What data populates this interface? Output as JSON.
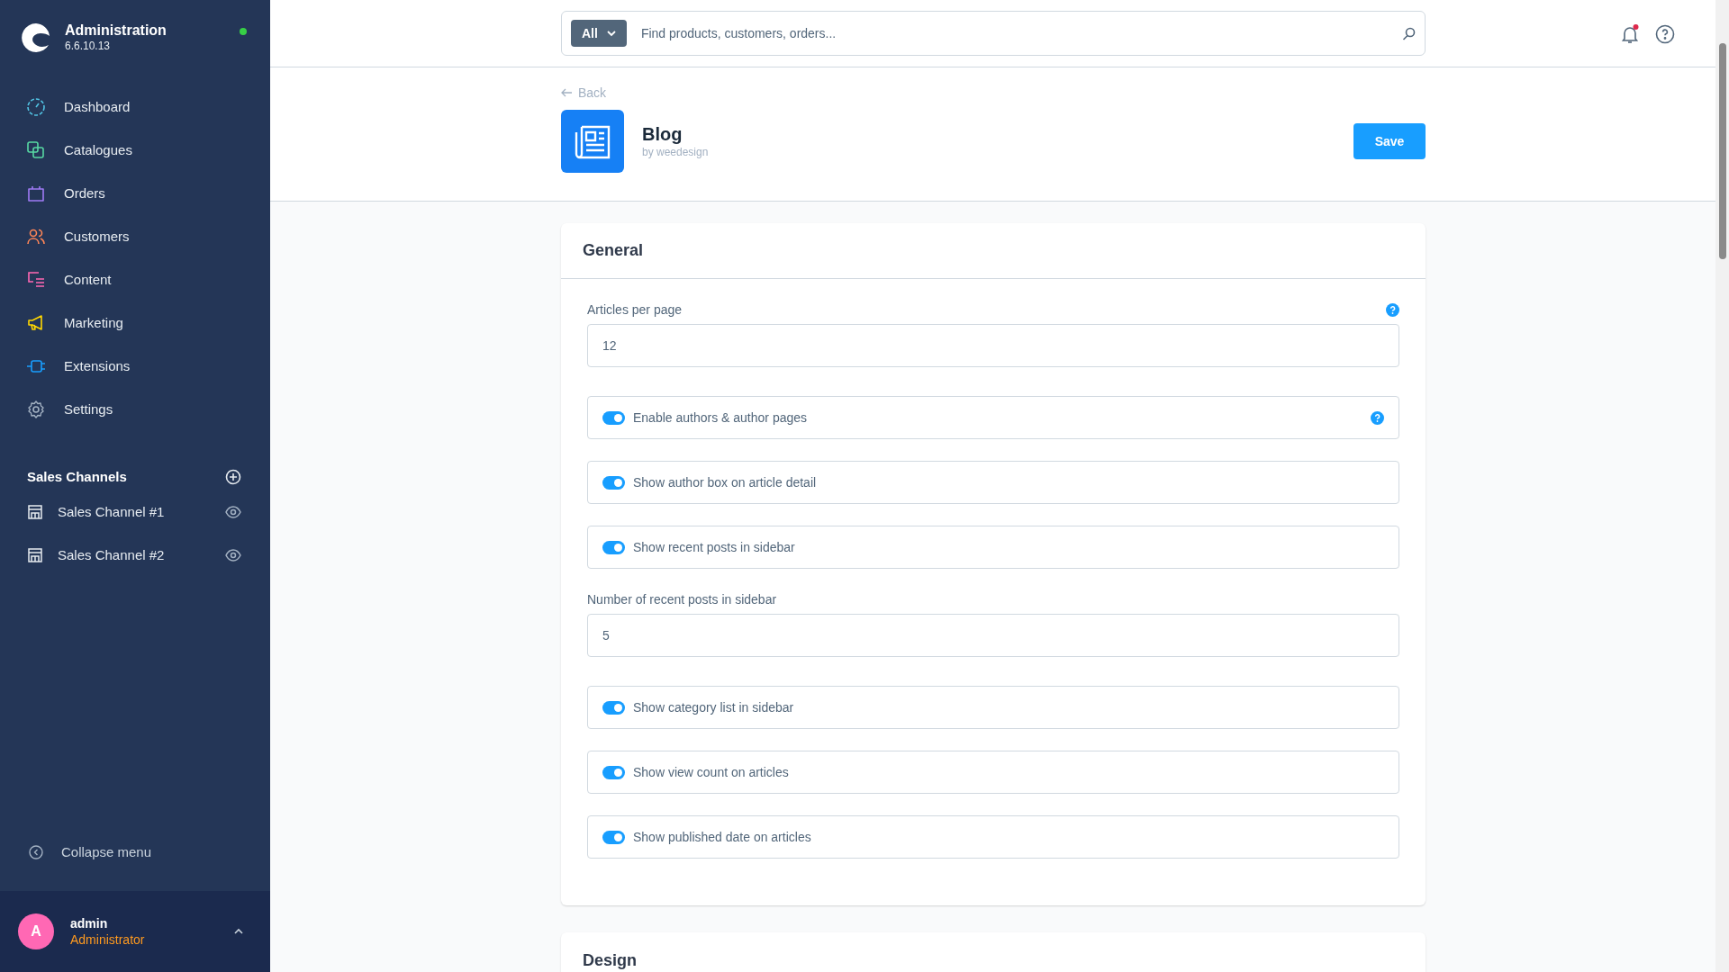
{
  "sidebar": {
    "title": "Administration",
    "version": "6.6.10.13",
    "nav": [
      {
        "label": "Dashboard"
      },
      {
        "label": "Catalogues"
      },
      {
        "label": "Orders"
      },
      {
        "label": "Customers"
      },
      {
        "label": "Content"
      },
      {
        "label": "Marketing"
      },
      {
        "label": "Extensions"
      },
      {
        "label": "Settings"
      }
    ],
    "sales_channels": {
      "heading": "Sales Channels",
      "items": [
        {
          "label": "Sales Channel #1"
        },
        {
          "label": "Sales Channel #2"
        }
      ]
    },
    "collapse": "Collapse menu",
    "user": {
      "initial": "A",
      "name": "admin",
      "role": "Administrator"
    }
  },
  "search": {
    "filter": "All",
    "placeholder": "Find products, customers, orders..."
  },
  "header": {
    "back": "Back",
    "title": "Blog",
    "subtitle": "by weedesign",
    "save": "Save"
  },
  "cards": [
    {
      "title": "General",
      "fields": [
        {
          "kind": "number",
          "label": "Articles per page",
          "value": "12",
          "help": true
        },
        {
          "kind": "toggle",
          "label": "Enable authors & author pages",
          "on": true,
          "help": true
        },
        {
          "kind": "toggle",
          "label": "Show author box on article detail",
          "on": true,
          "help": false
        },
        {
          "kind": "toggle",
          "label": "Show recent posts in sidebar",
          "on": true,
          "help": false
        },
        {
          "kind": "number",
          "label": "Number of recent posts in sidebar",
          "value": "5",
          "help": false
        },
        {
          "kind": "toggle",
          "label": "Show category list in sidebar",
          "on": true,
          "help": false
        },
        {
          "kind": "toggle",
          "label": "Show view count on articles",
          "on": true,
          "help": false
        },
        {
          "kind": "toggle",
          "label": "Show published date on articles",
          "on": true,
          "help": false
        }
      ]
    },
    {
      "title": "Design"
    }
  ]
}
